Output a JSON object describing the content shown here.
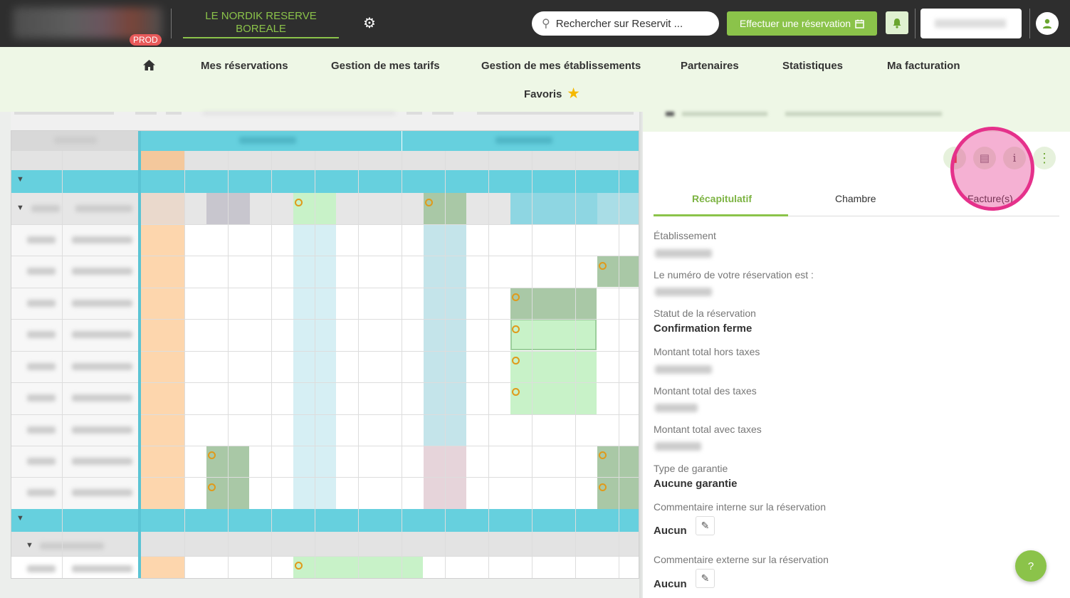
{
  "app": {
    "env_badge": "PROD",
    "hotel_name": "LE NORDIK RESERVE BOREALE",
    "colors": {
      "accent": "#8bc34a",
      "topbar": "#2e2e2e",
      "nav_bg": "#eef7e6",
      "highlight": "#e5318b",
      "grid_header": "#66d0de",
      "reservation": "#c8f2c8",
      "today_col": "#fdd6ad"
    }
  },
  "topbar": {
    "search": {
      "placeholder": "Rechercher sur Reservit ...",
      "icon": "search-icon"
    },
    "book_button": {
      "label": "Effectuer une réservation",
      "icon": "calendar-icon"
    },
    "icons": {
      "settings": "gear-icon",
      "notifications": "bell-icon",
      "account": "user-icon"
    }
  },
  "nav": {
    "home_icon": "home-icon",
    "items": [
      {
        "label": "Mes réservations"
      },
      {
        "label": "Gestion de mes tarifs"
      },
      {
        "label": "Gestion de mes établissements"
      },
      {
        "label": "Partenaires"
      },
      {
        "label": "Statistiques"
      },
      {
        "label": "Ma facturation"
      },
      {
        "label": "Favoris",
        "icon": "star-icon"
      }
    ]
  },
  "panel": {
    "actions": [
      "pdf-icon",
      "card-icon",
      "info-icon",
      "more-vertical-icon"
    ],
    "tabs": [
      {
        "label": "Récapitulatif",
        "active": true
      },
      {
        "label": "Chambre",
        "active": false
      },
      {
        "label": "Facture(s)",
        "active": false
      }
    ],
    "fields": [
      {
        "label": "Établissement"
      },
      {
        "label": "Le numéro de votre réservation est :"
      },
      {
        "label": "Statut de la réservation",
        "value": "Confirmation ferme"
      },
      {
        "label": "Montant total hors taxes"
      },
      {
        "label": "Montant total des taxes"
      },
      {
        "label": "Montant total avec taxes"
      },
      {
        "label": "Type de garantie",
        "value": "Aucune garantie"
      },
      {
        "label": "Commentaire interne sur la réservation",
        "value": "Aucun"
      },
      {
        "label": "Commentaire externe sur la réservation",
        "value": "Aucun"
      }
    ],
    "help_label": "?"
  }
}
